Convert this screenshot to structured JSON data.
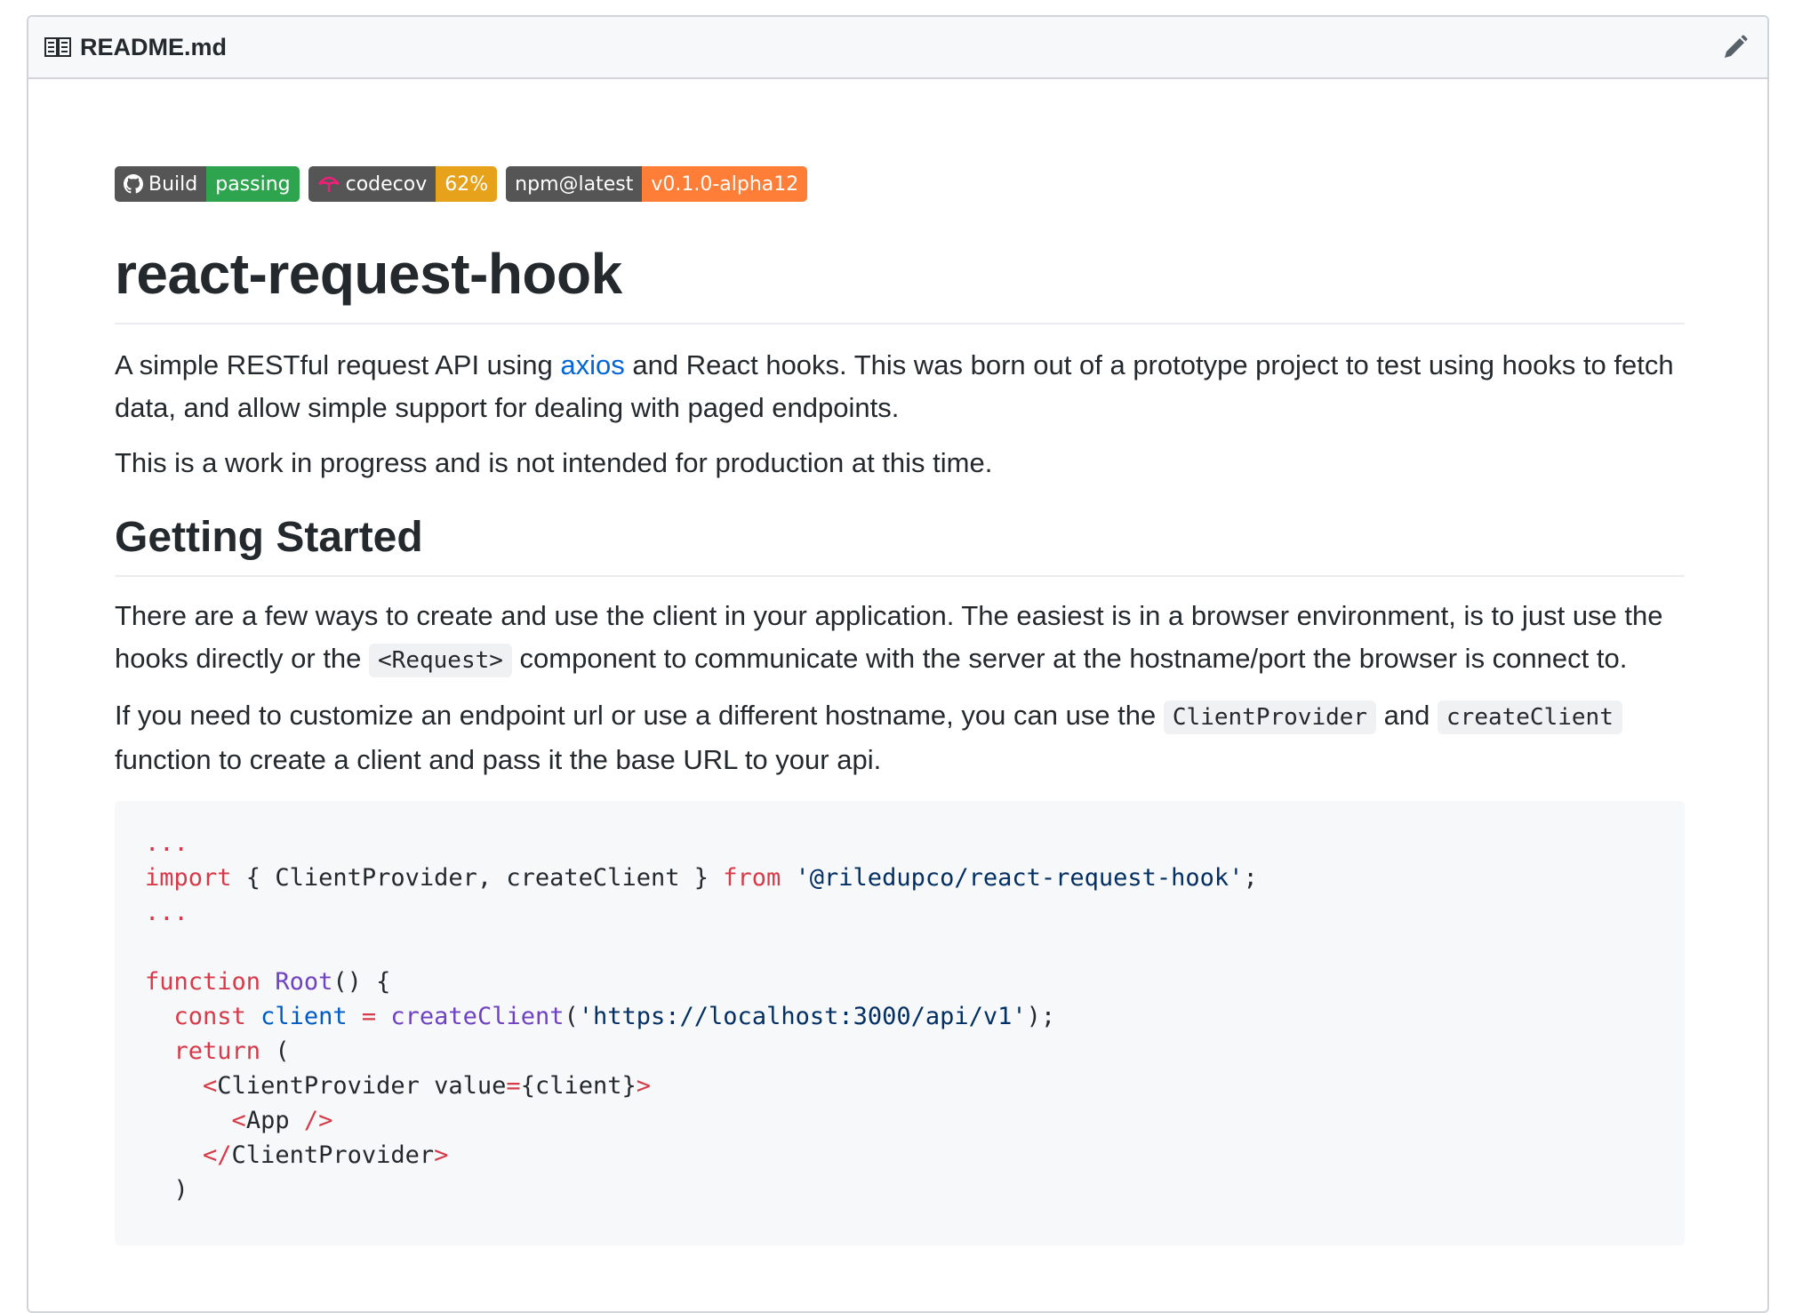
{
  "file_header": {
    "icon": "book-icon",
    "filename": "README.md",
    "edit_icon": "pencil-icon"
  },
  "badges": [
    {
      "label": "Build",
      "value": "passing",
      "color": "#2ea44f",
      "icon": "github-icon"
    },
    {
      "label": "codecov",
      "value": "62%",
      "color": "#e5a21a",
      "icon": "codecov-umbrella-icon"
    },
    {
      "label": "npm@latest",
      "value": "v0.1.0-alpha12",
      "color": "#fe7d37"
    }
  ],
  "readme": {
    "title": "react-request-hook",
    "intro_before_link": "A simple RESTful request API using ",
    "intro_link": "axios",
    "intro_after_link": " and React hooks. This was born out of a prototype project to test using hooks to fetch data, and allow simple support for dealing with paged endpoints.",
    "wip": "This is a work in progress and is not intended for production at this time.",
    "section_title": "Getting Started",
    "p1_a": "There are a few ways to create and use the client in your application. The easiest is in a browser environment, is to just use the hooks directly or the ",
    "p1_code": "<Request>",
    "p1_b": " component to communicate with the server at the hostname/port the browser is connect to.",
    "p2_a": "If you need to customize an endpoint url or use a different hostname, you can use the ",
    "p2_code1": "ClientProvider",
    "p2_b": " and ",
    "p2_code2": "createClient",
    "p2_c": " function to create a client and pass it the base URL to your api."
  },
  "code": {
    "dots": "...",
    "import_kw": "import",
    "import_names": " { ClientProvider, createClient } ",
    "from_kw": "from",
    "import_str": "'@riledupco/react-request-hook'",
    "semi": ";",
    "function_kw": "function",
    "fn_name": "Root",
    "fn_sig": "() {",
    "const_kw": "const",
    "client_var": "client",
    "eq": "=",
    "create_fn": "createClient",
    "url_str": "'https://localhost:3000/api/v1'",
    "call_end": ");",
    "open_paren": "(",
    "paren_close": ")",
    "return_kw": "return",
    "lt": "<",
    "gt": ">",
    "provider_tag": "ClientProvider",
    "value_attr": " value",
    "value_expr": "{client}",
    "app_tag": "App",
    "self_close": " />",
    "close_tag_open": "</"
  }
}
